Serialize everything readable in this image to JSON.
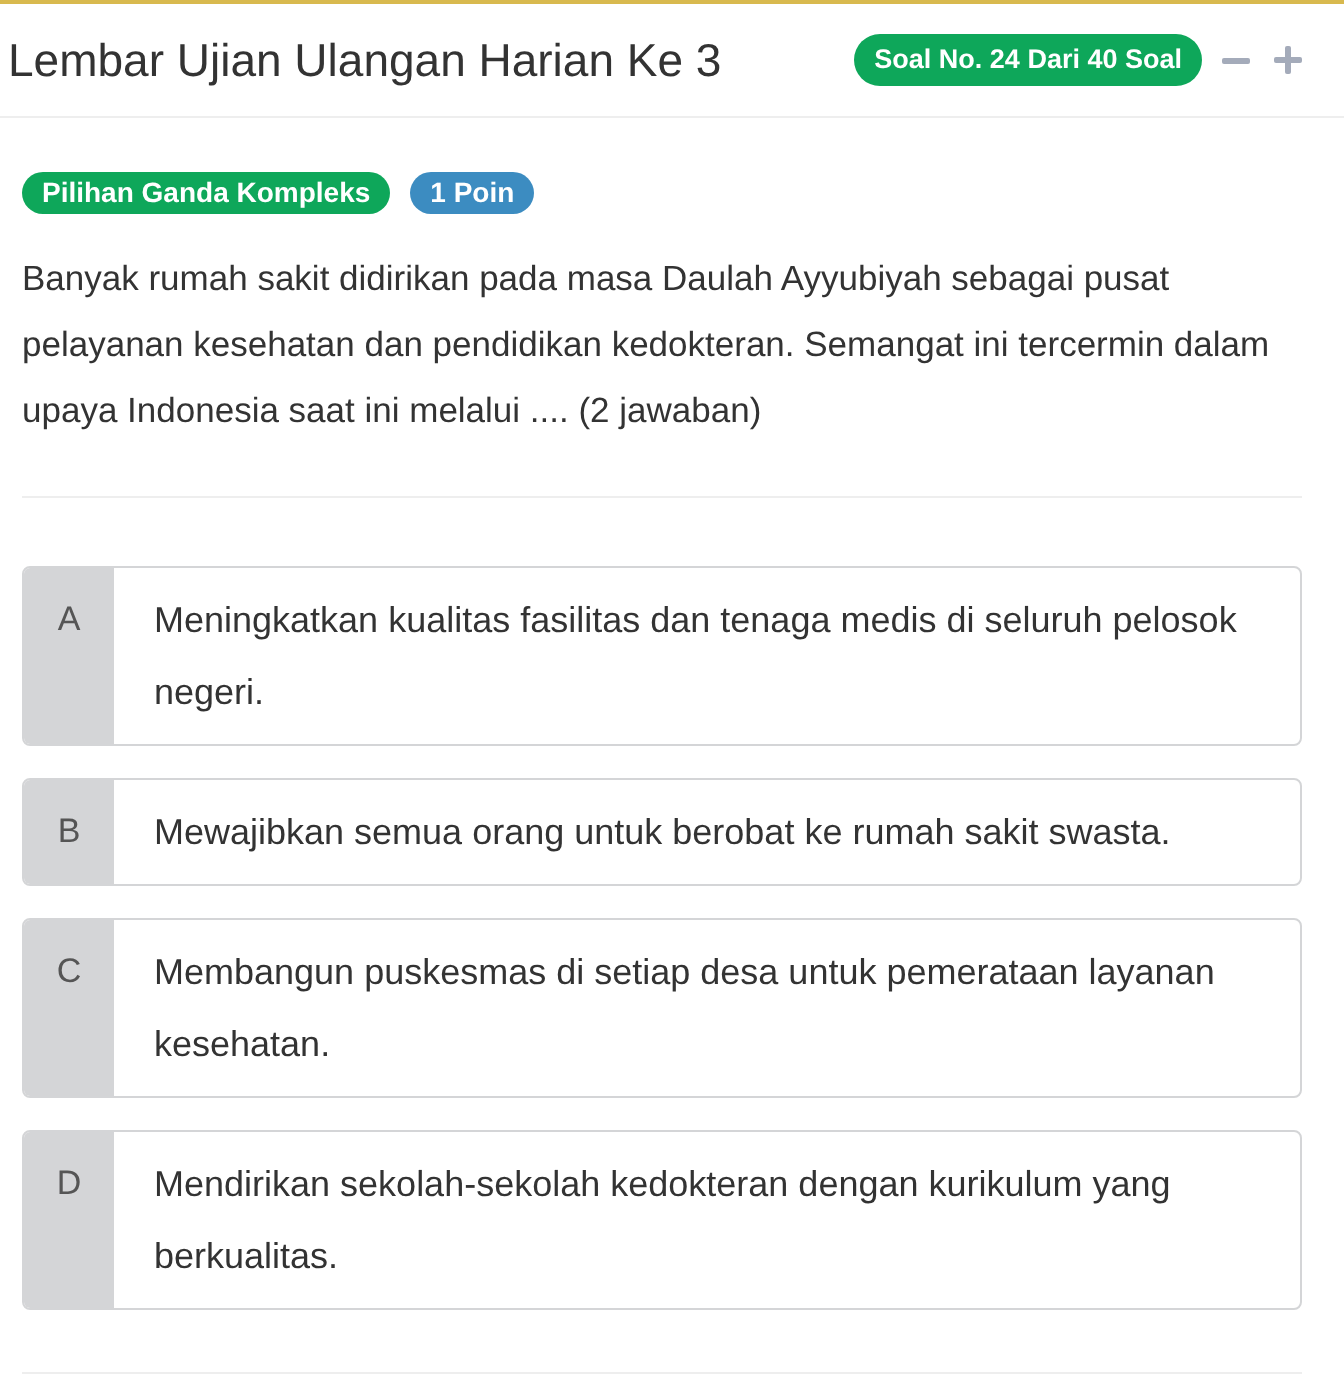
{
  "header": {
    "title": "Lembar Ujian Ulangan Harian Ke 3",
    "counter_badge": "Soal No. 24 Dari 40 Soal"
  },
  "tags": [
    {
      "label": "Pilihan Ganda Kompleks",
      "color": "#0ea75a"
    },
    {
      "label": "1 Poin",
      "color": "#3c8cc1"
    }
  ],
  "question": "Banyak rumah sakit didirikan pada masa Daulah Ayyubiyah sebagai pusat pelayanan kesehatan dan pendidikan kedokteran. Semangat ini tercermin dalam upaya Indonesia saat ini melalui .... (2 jawaban)",
  "options": [
    {
      "letter": "A",
      "text": "Meningkatkan kualitas fasilitas dan tenaga medis di seluruh pelosok negeri.",
      "selected": false
    },
    {
      "letter": "B",
      "text": "Mewajibkan semua orang untuk berobat ke rumah sakit swasta.",
      "selected": false
    },
    {
      "letter": "C",
      "text": "Membangun puskesmas di setiap desa untuk pemerataan layanan kesehatan.",
      "selected": false
    },
    {
      "letter": "D",
      "text": "Mendirikan sekolah-sekolah kedokteran dengan kurikulum yang berkualitas.",
      "selected": false
    }
  ]
}
